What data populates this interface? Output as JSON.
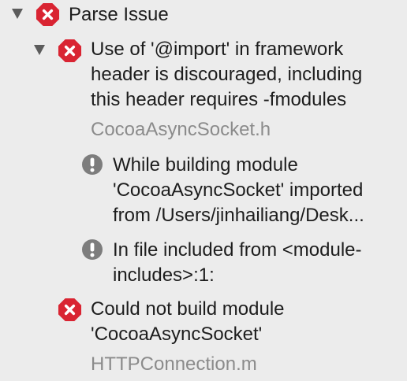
{
  "colors": {
    "background": "#ececec",
    "error_red": "#d92432",
    "note_gray": "#7d7d7d",
    "file_gray": "#8b8b8b"
  },
  "issues": {
    "group": {
      "icon": "error-icon",
      "title": "Parse Issue"
    },
    "item1": {
      "icon": "error-icon",
      "message_lines": [
        "Use of '@import' in framework",
        "header is discouraged, including",
        "this header requires -fmodules"
      ],
      "file": "CocoaAsyncSocket.h"
    },
    "note1": {
      "icon": "note-icon",
      "message_lines": [
        "While building module",
        "'CocoaAsyncSocket' imported",
        "from /Users/jinhailiang/Desk..."
      ]
    },
    "note2": {
      "icon": "note-icon",
      "message_lines": [
        "In file included from <module-",
        "includes>:1:"
      ]
    },
    "item2": {
      "icon": "error-icon",
      "message_lines": [
        "Could not build module",
        "'CocoaAsyncSocket'"
      ],
      "file": "HTTPConnection.m"
    }
  }
}
